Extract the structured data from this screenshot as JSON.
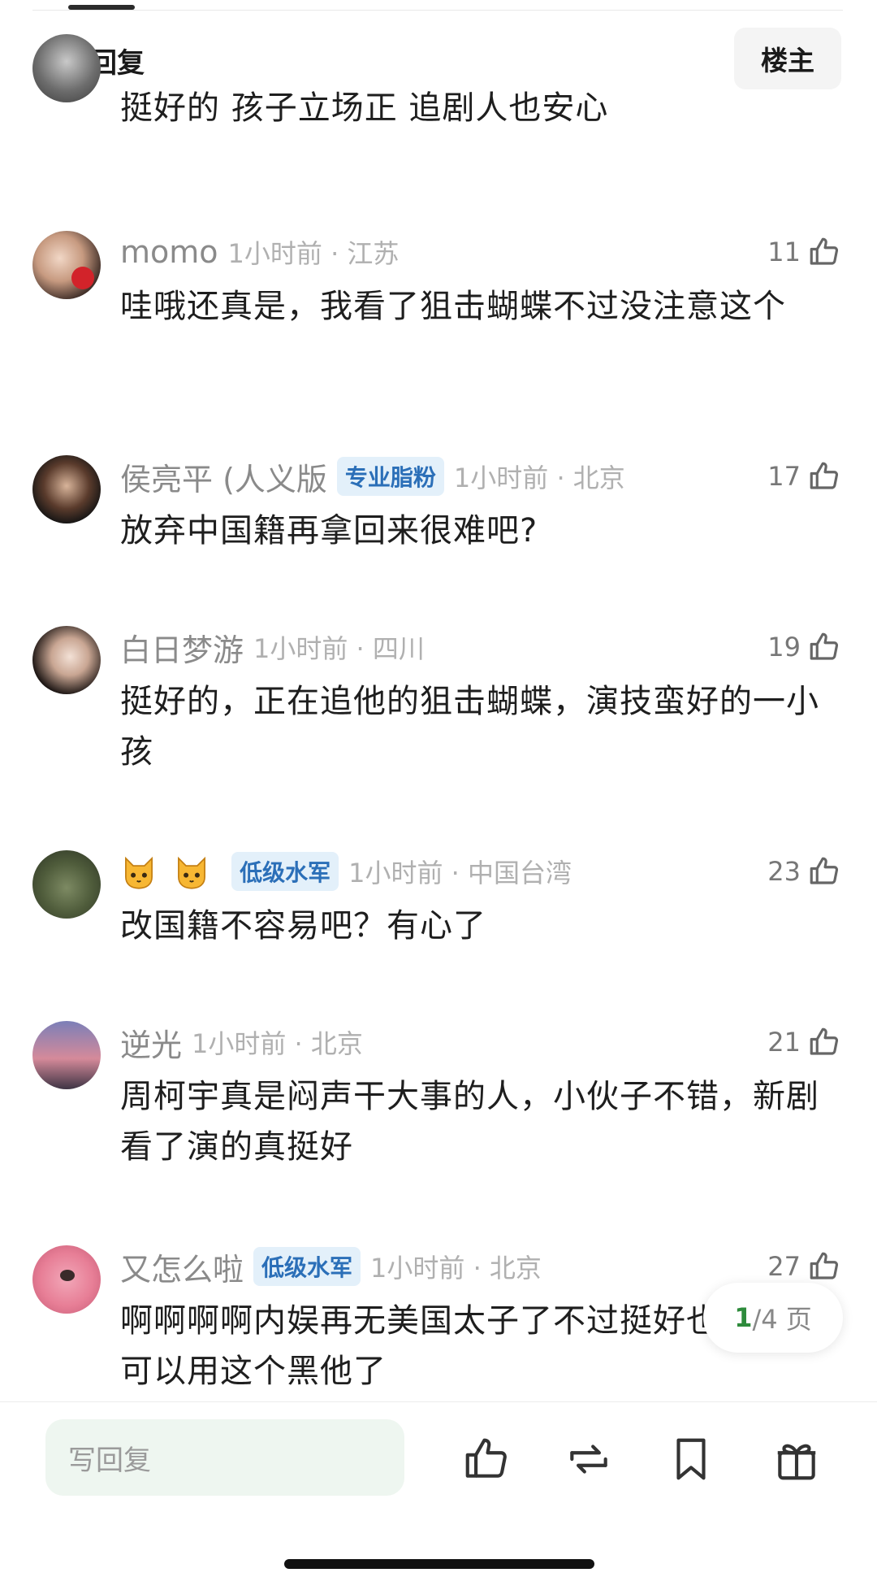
{
  "header": {
    "title": "全部回复",
    "op_button": "楼主"
  },
  "comments": [
    {
      "text": "挺好的 孩子立场正 追剧人也安心"
    },
    {
      "username": "momo",
      "time": "1小时前 · 江苏",
      "likes": "11",
      "text": "哇哦还真是，我看了狙击蝴蝶不过没注意这个"
    },
    {
      "username": "侯亮平 (人义版",
      "badge": "专业脂粉",
      "time": "1小时前 · 北京",
      "likes": "17",
      "text": "放弃中国籍再拿回来很难吧?"
    },
    {
      "username": "白日梦游",
      "time": "1小时前 · 四川",
      "likes": "19",
      "text": "挺好的，正在追他的狙击蝴蝶，演技蛮好的一小孩"
    },
    {
      "username_icons": [
        "cat-face",
        "cat-face"
      ],
      "badge": "低级水军",
      "time": "1小时前 · 中国台湾",
      "likes": "23",
      "text": "改国籍不容易吧？有心了"
    },
    {
      "username": "逆光",
      "time": "1小时前 · 北京",
      "likes": "21",
      "text": "周柯宇真是闷声干大事的人，小伙子不错，新剧看了演的真挺好"
    },
    {
      "username": "又怎么啦",
      "badge": "低级水军",
      "time": "1小时前 · 北京",
      "likes": "27",
      "text": "啊啊啊啊内娱再无美国太子了不过挺好也没有人可以用这个黑他了"
    }
  ],
  "pagination": {
    "current": "1",
    "total": "/4 页"
  },
  "bottom_bar": {
    "reply_placeholder": "写回复",
    "actions": [
      "like-icon",
      "repost-icon",
      "bookmark-icon",
      "gift-icon"
    ]
  },
  "colors": {
    "badge_text": "#2b6fb8",
    "badge_bg": "#e3f0fa",
    "page_current": "#2e8b3c",
    "reply_bg": "#eef6f0"
  }
}
